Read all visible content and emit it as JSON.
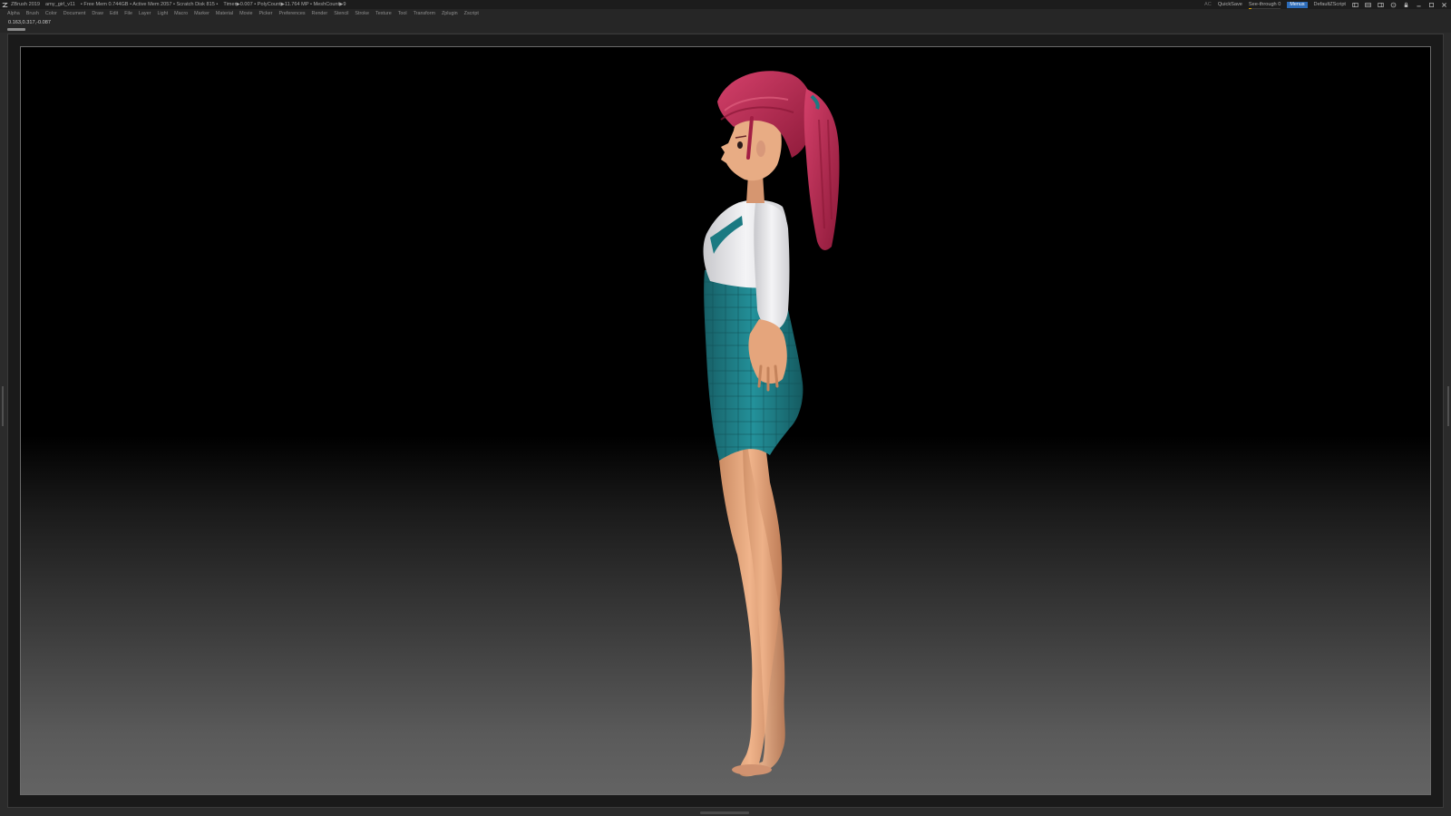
{
  "titlebar": {
    "app": "ZBrush 2019",
    "file": "amy_girl_v11",
    "stats": "• Free Mem 0.744GB • Active Mem 2057 • Scratch Disk 815 •",
    "timer": "Timer▶0.007 • PolyCount▶11.764 MP • MeshCount▶9",
    "ac": "AC",
    "quicksave": "QuickSave",
    "see_through_label": "See-through",
    "see_through_value": "0",
    "see_through_fraction": 0,
    "menus_toggle": "Menus",
    "script": "DefaultZScript",
    "icons": [
      "layout-icon",
      "layout-icon",
      "layout-icon",
      "help-icon",
      "lock-icon",
      "minimize-icon",
      "maximize-icon",
      "close-icon"
    ]
  },
  "menu_items": [
    "Alpha",
    "Brush",
    "Color",
    "Document",
    "Draw",
    "Edit",
    "File",
    "Layer",
    "Light",
    "Macro",
    "Marker",
    "Material",
    "Movie",
    "Picker",
    "Preferences",
    "Render",
    "Stencil",
    "Stroke",
    "Texture",
    "Tool",
    "Transform",
    "Zplugin",
    "Zscript"
  ],
  "coords": "0.163,0.317,-0.087",
  "colors": {
    "accent": "#2c6bb8",
    "slider_fill": "#d8a000",
    "hair": "#b8244f",
    "skin": "#e6a87e",
    "shirt": "#e8e8ea",
    "skirt": "#1f7f86"
  }
}
